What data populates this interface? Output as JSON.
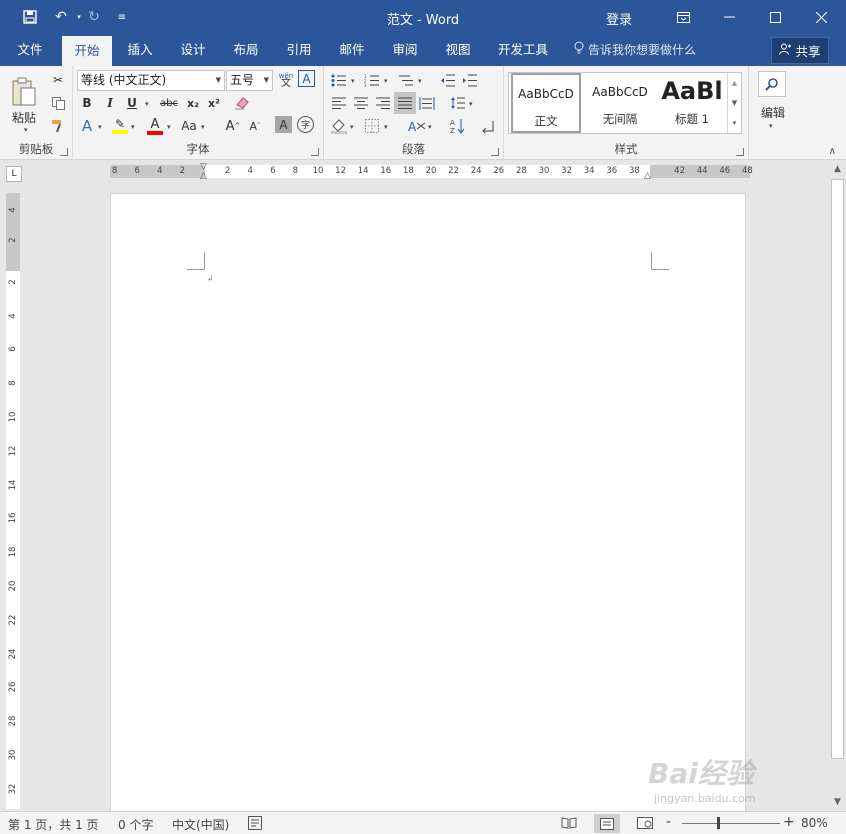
{
  "titlebar": {
    "title": "范文 - Word",
    "login": "登录",
    "qa_icons": [
      "save-icon",
      "undo-icon",
      "redo-icon",
      "customize-icon"
    ],
    "window_buttons": [
      "ribbon-display-icon",
      "minimize-icon",
      "maximize-icon",
      "close-icon"
    ]
  },
  "tabs": [
    {
      "label": "文件"
    },
    {
      "label": "开始",
      "active": true
    },
    {
      "label": "插入"
    },
    {
      "label": "设计"
    },
    {
      "label": "布局"
    },
    {
      "label": "引用"
    },
    {
      "label": "邮件"
    },
    {
      "label": "审阅"
    },
    {
      "label": "视图"
    },
    {
      "label": "开发工具"
    }
  ],
  "tell_me": "告诉我你想要做什么",
  "share": "共享",
  "ribbon": {
    "clipboard": {
      "label": "剪贴板",
      "paste": "粘贴"
    },
    "font": {
      "label": "字体",
      "font_name": "等线 (中文正文)",
      "font_size": "五号",
      "wen": "文",
      "phonetic": "wén",
      "bold": "B",
      "italic": "I",
      "underline": "U",
      "strike": "abc",
      "sub": "x₂",
      "sup": "x²",
      "aa": "Aa",
      "grow": "A",
      "shrink": "A",
      "shade": "A",
      "circle": "字"
    },
    "paragraph": {
      "label": "段落"
    },
    "styles": {
      "label": "样式",
      "items": [
        {
          "preview": "AaBbCcD",
          "name": "正文"
        },
        {
          "preview": "AaBbCcD",
          "name": "无间隔"
        },
        {
          "preview": "AaBl",
          "name": "标题 1"
        }
      ]
    },
    "editing": {
      "label": "编辑"
    }
  },
  "ruler": {
    "corner": "L",
    "left_ticks": [
      "8",
      "6",
      "4",
      "2"
    ],
    "right_ticks": [
      "2",
      "4",
      "6",
      "8",
      "10",
      "12",
      "14",
      "16",
      "18",
      "20",
      "22",
      "24",
      "26",
      "28",
      "30",
      "32",
      "34",
      "36",
      "38",
      "42",
      "44",
      "46",
      "48"
    ],
    "vertical_ticks": [
      "4",
      "2",
      "2",
      "4",
      "6",
      "8",
      "10",
      "12",
      "14",
      "16",
      "18",
      "20",
      "22",
      "24",
      "26",
      "28",
      "30",
      "32"
    ]
  },
  "status": {
    "page": "第 1 页，共 1 页",
    "words": "0 个字",
    "language": "中文(中国)",
    "zoom": "80%",
    "zoom_minus": "-",
    "zoom_plus": "+"
  },
  "watermark": {
    "text": "Bai经验",
    "url": "jingyan.baidu.com"
  },
  "colors": {
    "accent": "#2b579a",
    "highlight": "#ffff00",
    "font_color": "#ff0000"
  }
}
